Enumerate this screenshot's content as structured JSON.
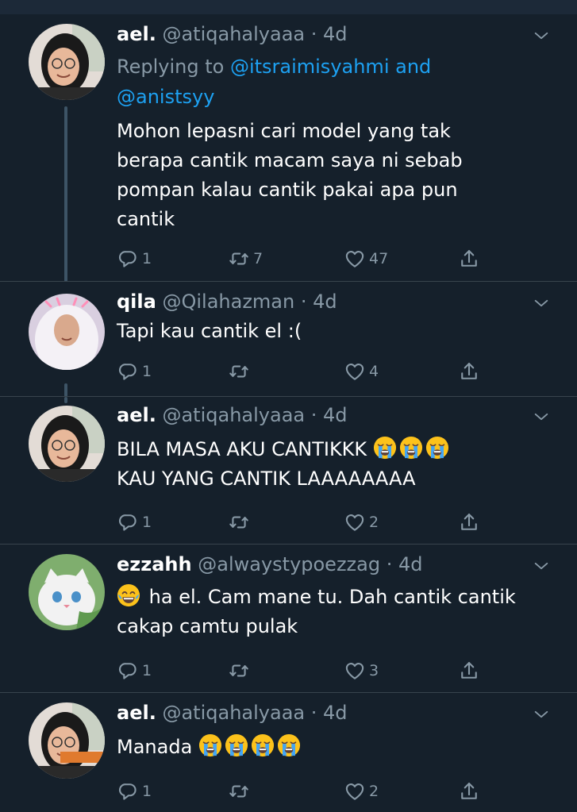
{
  "tweets": [
    {
      "name": "ael.",
      "handle": "@atiqahalyaaa",
      "dot": "·",
      "time": "4d",
      "reply_prefix": "Replying to ",
      "reply_user1": "@itsraimisyahmi",
      "reply_and": " and",
      "reply_user2": "@anistsyy",
      "text_lines": [
        "Mohon lepasni cari model yang tak",
        "berapa cantik macam saya ni sebab",
        "pompan kalau cantik pakai apa pun",
        "cantik"
      ],
      "replies": "1",
      "retweets": "7",
      "likes": "47"
    },
    {
      "name": "qila",
      "handle": "@Qilahazman",
      "dot": "·",
      "time": "4d",
      "text_lines": [
        "Tapi kau cantik el :("
      ],
      "replies": "1",
      "retweets": "",
      "likes": "4"
    },
    {
      "name": "ael.",
      "handle": "@atiqahalyaaa",
      "dot": "·",
      "time": "4d",
      "text_line1": "BILA MASA AKU CANTIKKK",
      "text_line1_emoji": [
        "loudly-crying-face",
        "loudly-crying-face",
        "loudly-crying-face"
      ],
      "text_line2": "KAU YANG CANTIK LAAAAAAAA",
      "replies": "1",
      "retweets": "",
      "likes": "2"
    },
    {
      "name": "ezzahh",
      "handle": "@alwaystypoezzag",
      "dot": "·",
      "time": "4d",
      "text_emoji": "face-with-tears-of-joy",
      "text_line1": "ha el. Cam mane tu. Dah cantik cantik",
      "text_line2": "cakap camtu pulak",
      "replies": "1",
      "retweets": "",
      "likes": "3"
    },
    {
      "name": "ael.",
      "handle": "@atiqahalyaaa",
      "dot": "·",
      "time": "4d",
      "text_line1": "Manada",
      "text_line1_emoji": [
        "loudly-crying-face",
        "loudly-crying-face",
        "loudly-crying-face",
        "loudly-crying-face"
      ],
      "replies": "1",
      "retweets": "",
      "likes": "2"
    }
  ],
  "colors": {
    "background": "#15202b",
    "text": "#ffffff",
    "muted": "#8899a6",
    "link": "#1da1f2",
    "divider": "#38444d",
    "thread_line": "#3d5466"
  }
}
